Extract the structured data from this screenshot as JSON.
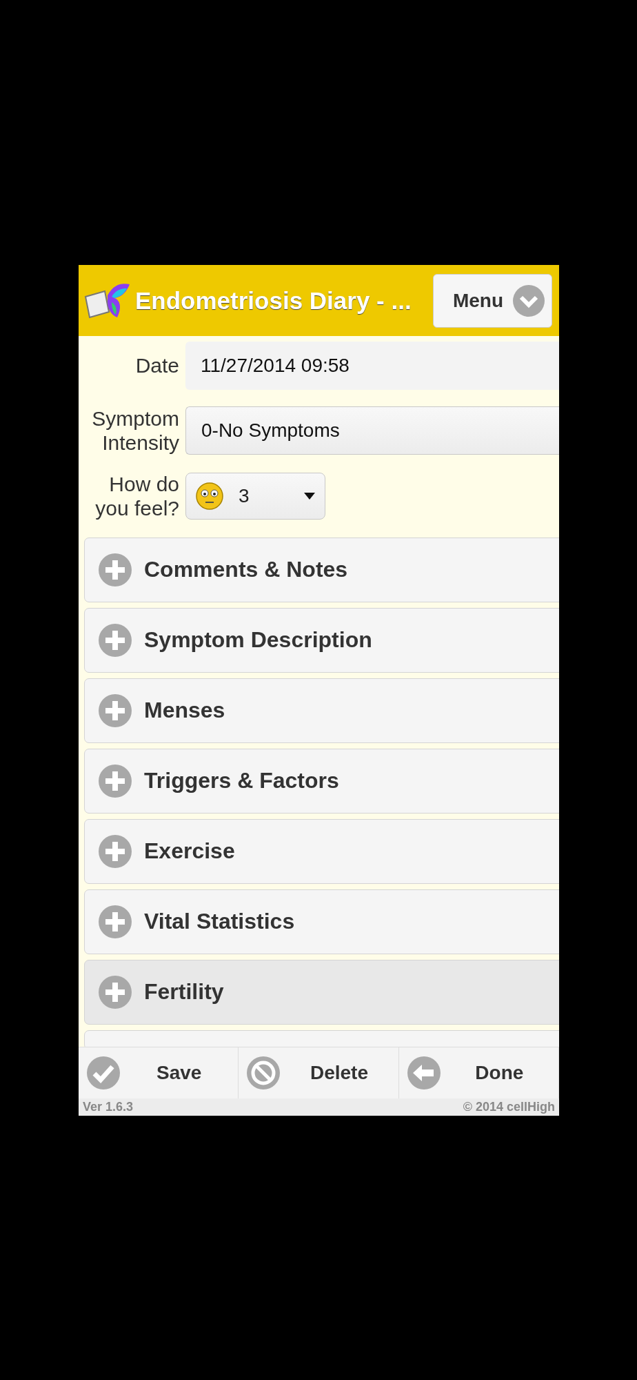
{
  "header": {
    "title": "Endometriosis Diary - ...",
    "menu_button": "Menu"
  },
  "fields": [
    {
      "kind": "text",
      "label": "Date",
      "value": "11/27/2014 09:58"
    },
    {
      "kind": "select",
      "label": "Symptom Intensity",
      "value": "0-No Symptoms"
    },
    {
      "kind": "mood",
      "label": "How do you feel?",
      "value": "3"
    }
  ],
  "sections": [
    {
      "label": "Comments & Notes",
      "highlighted": false
    },
    {
      "label": "Symptom Description",
      "highlighted": false
    },
    {
      "label": "Menses",
      "highlighted": false
    },
    {
      "label": "Triggers & Factors",
      "highlighted": false
    },
    {
      "label": "Exercise",
      "highlighted": false
    },
    {
      "label": "Vital Statistics",
      "highlighted": false
    },
    {
      "label": "Fertility",
      "highlighted": true
    },
    {
      "kind": "partial",
      "highlighted": false
    }
  ],
  "footer": {
    "buttons": [
      {
        "kind": "save",
        "label": "Save"
      },
      {
        "kind": "delete",
        "label": "Delete"
      },
      {
        "kind": "done",
        "label": "Done"
      }
    ],
    "version": "Ver 1.6.3",
    "copyright": "© 2014 cellHigh"
  }
}
